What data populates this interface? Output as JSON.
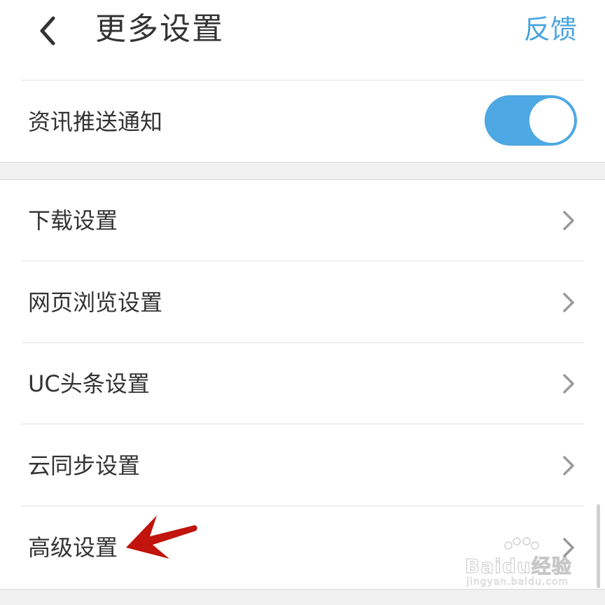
{
  "header": {
    "title": "更多设置",
    "feedback_label": "反馈",
    "accent_color": "#4aa4e0"
  },
  "icons": {
    "back": "chevron-left-icon",
    "row_arrow": "chevron-right-icon"
  },
  "push_section": {
    "label": "资讯推送通知",
    "toggle_on": true,
    "toggle_color": "#4ea8e3"
  },
  "settings": {
    "items": [
      {
        "label": "下载设置"
      },
      {
        "label": "网页浏览设置"
      },
      {
        "label": "UC头条设置"
      },
      {
        "label": "云同步设置"
      },
      {
        "label": "高级设置"
      }
    ]
  },
  "annotation": {
    "arrow_color": "#c0140c"
  },
  "watermark": {
    "brand": "Baidu经验",
    "url": "jingyan.baidu.com"
  }
}
